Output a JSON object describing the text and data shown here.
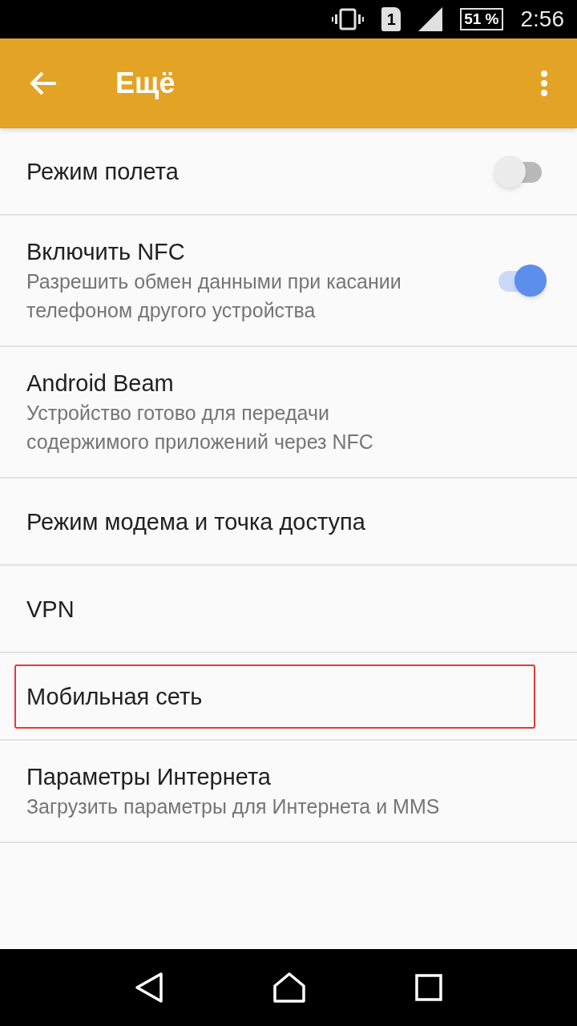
{
  "status_bar": {
    "sim": "1",
    "battery": "51 %",
    "time": "2:56"
  },
  "app_bar": {
    "title": "Ещё"
  },
  "items": [
    {
      "kind": "switch",
      "title": "Режим полета",
      "on": false
    },
    {
      "kind": "switch",
      "title": "Включить NFC",
      "subtitle": "Разрешить обмен данными при касании телефоном другого устройства",
      "on": true
    },
    {
      "kind": "plain",
      "title": "Android Beam",
      "subtitle": "Устройство готово для передачи содержимого приложений через NFC"
    },
    {
      "kind": "plain",
      "title": "Режим модема и точка доступа"
    },
    {
      "kind": "plain",
      "title": "VPN"
    },
    {
      "kind": "plain",
      "title": "Мобильная сеть",
      "highlighted": true
    },
    {
      "kind": "plain",
      "title": "Параметры Интернета",
      "subtitle": "Загрузить параметры для Интернета и MMS"
    }
  ]
}
